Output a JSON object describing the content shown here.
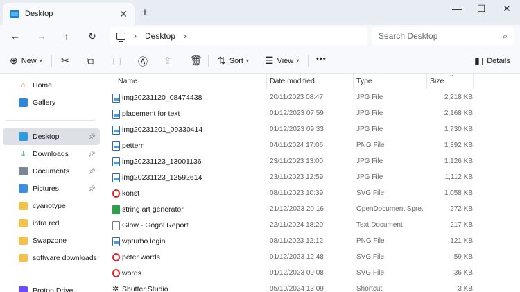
{
  "window": {
    "tab_title": "Desktop",
    "new_tab": "+",
    "minimize": "—",
    "maximize": "☐",
    "close": "✕"
  },
  "address": {
    "location": "Desktop",
    "search_placeholder": "Search Desktop"
  },
  "toolbar": {
    "new_label": "New",
    "sort_label": "Sort",
    "view_label": "View",
    "more_label": "•••",
    "details_label": "Details"
  },
  "sidebar": {
    "items": [
      {
        "label": "Home",
        "icon": "home-icon"
      },
      {
        "label": "Gallery",
        "icon": "gallery-icon"
      },
      {
        "label": "Desktop",
        "icon": "desktop-icon",
        "pinned": true
      },
      {
        "label": "Downloads",
        "icon": "download-icon",
        "pinned": true
      },
      {
        "label": "Documents",
        "icon": "documents-icon",
        "pinned": true
      },
      {
        "label": "Pictures",
        "icon": "pictures-icon",
        "pinned": true
      },
      {
        "label": "cyanotype",
        "icon": "folder-icon"
      },
      {
        "label": "infra red",
        "icon": "folder-icon"
      },
      {
        "label": "Swapzone",
        "icon": "folder-icon"
      },
      {
        "label": "software downloads",
        "icon": "folder-icon"
      },
      {
        "label": "Proton Drive",
        "icon": "cloud-icon"
      }
    ]
  },
  "columns": {
    "name": "Name",
    "date": "Date modified",
    "type": "Type",
    "size": "Size"
  },
  "files": [
    {
      "name": "img20231120_08474438",
      "date": "20/11/2023 08:47",
      "type": "JPG File",
      "size": "2,218 KB",
      "icon": "image-file-icon"
    },
    {
      "name": "placement for text",
      "date": "01/12/2023 07:59",
      "type": "JPG File",
      "size": "2,168 KB",
      "icon": "image-file-icon"
    },
    {
      "name": "img20231201_09330414",
      "date": "01/12/2023 09:33",
      "type": "JPG File",
      "size": "1,730 KB",
      "icon": "image-file-icon"
    },
    {
      "name": "pettern",
      "date": "04/11/2024 17:06",
      "type": "PNG File",
      "size": "1,392 KB",
      "icon": "image-file-icon"
    },
    {
      "name": "img20231123_13001136",
      "date": "23/11/2023 13:00",
      "type": "JPG File",
      "size": "1,126 KB",
      "icon": "image-file-icon"
    },
    {
      "name": "img20231123_12592614",
      "date": "23/11/2023 12:59",
      "type": "JPG File",
      "size": "1,112 KB",
      "icon": "image-file-icon"
    },
    {
      "name": "konst",
      "date": "08/11/2023 10:39",
      "type": "SVG File",
      "size": "1,058 KB",
      "icon": "svg-file-icon"
    },
    {
      "name": "string art generator",
      "date": "21/12/2023 20:16",
      "type": "OpenDocument Spre...",
      "size": "272 KB",
      "icon": "spreadsheet-file-icon"
    },
    {
      "name": "Glow - Gogol Report",
      "date": "22/11/2024 18:20",
      "type": "Text Document",
      "size": "217 KB",
      "icon": "text-file-icon"
    },
    {
      "name": "wpturbo login",
      "date": "08/11/2023 12:12",
      "type": "PNG File",
      "size": "121 KB",
      "icon": "image-file-icon"
    },
    {
      "name": "peter words",
      "date": "01/12/2023 12:48",
      "type": "SVG File",
      "size": "59 KB",
      "icon": "svg-file-icon"
    },
    {
      "name": "words",
      "date": "01/12/2023 09:08",
      "type": "SVG File",
      "size": "36 KB",
      "icon": "svg-file-icon"
    },
    {
      "name": "Shutter Studio",
      "date": "05/10/2024 13:09",
      "type": "Shortcut",
      "size": "3 KB",
      "icon": "shortcut-file-icon"
    }
  ]
}
